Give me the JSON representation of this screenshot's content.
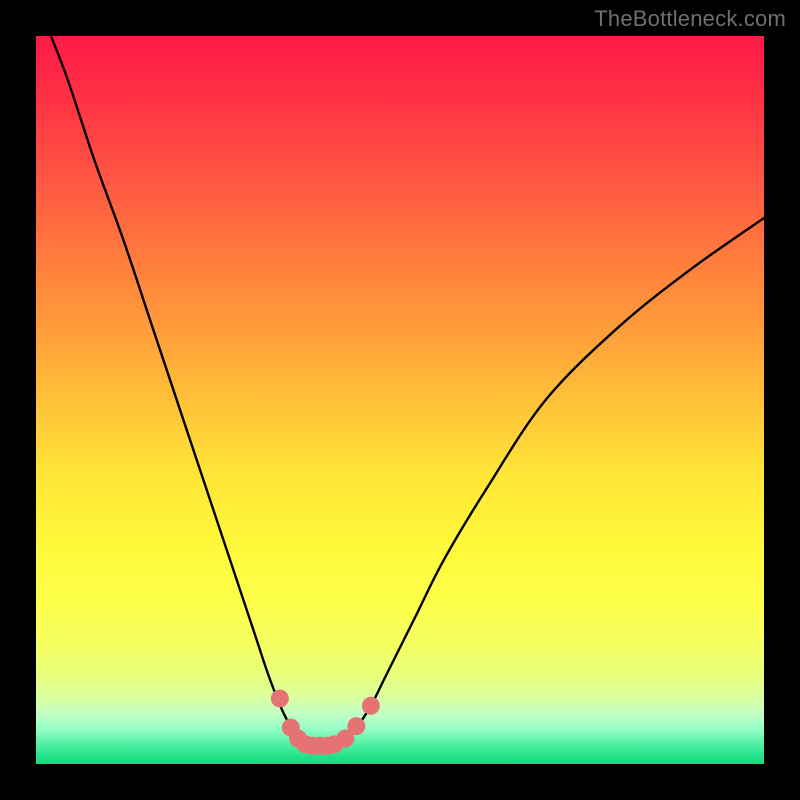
{
  "watermark": "TheBottleneck.com",
  "chart_data": {
    "type": "line",
    "title": "",
    "xlabel": "",
    "ylabel": "",
    "xlim": [
      0,
      100
    ],
    "ylim": [
      0,
      100
    ],
    "grid": false,
    "series": [
      {
        "name": "bottleneck-curve",
        "color": "#000000",
        "x": [
          0,
          4,
          8,
          12,
          16,
          20,
          24,
          28,
          30,
          32,
          34,
          36,
          37,
          38,
          40,
          42,
          44,
          46,
          48,
          52,
          56,
          62,
          70,
          80,
          90,
          100
        ],
        "y": [
          105,
          95,
          83,
          72,
          60,
          48,
          36,
          24,
          18,
          12,
          7,
          3.5,
          2.5,
          2.5,
          2.5,
          3,
          5,
          8,
          12,
          20,
          28,
          38,
          50,
          60,
          68,
          75
        ]
      }
    ],
    "markers": {
      "name": "highlight-dots",
      "color": "#e57373",
      "radius_px": 9,
      "points": [
        {
          "x": 33.5,
          "y": 9
        },
        {
          "x": 35,
          "y": 5
        },
        {
          "x": 36,
          "y": 3.5
        },
        {
          "x": 37,
          "y": 2.7
        },
        {
          "x": 38,
          "y": 2.5
        },
        {
          "x": 39,
          "y": 2.5
        },
        {
          "x": 40,
          "y": 2.5
        },
        {
          "x": 41,
          "y": 2.7
        },
        {
          "x": 42.5,
          "y": 3.5
        },
        {
          "x": 44,
          "y": 5.2
        },
        {
          "x": 46,
          "y": 8
        }
      ]
    },
    "background": {
      "type": "vertical-gradient",
      "stops": [
        {
          "pos": 0.0,
          "color": "#ff1b46"
        },
        {
          "pos": 0.5,
          "color": "#ffc038"
        },
        {
          "pos": 0.78,
          "color": "#fdff4a"
        },
        {
          "pos": 1.0,
          "color": "#10db7c"
        }
      ]
    }
  }
}
